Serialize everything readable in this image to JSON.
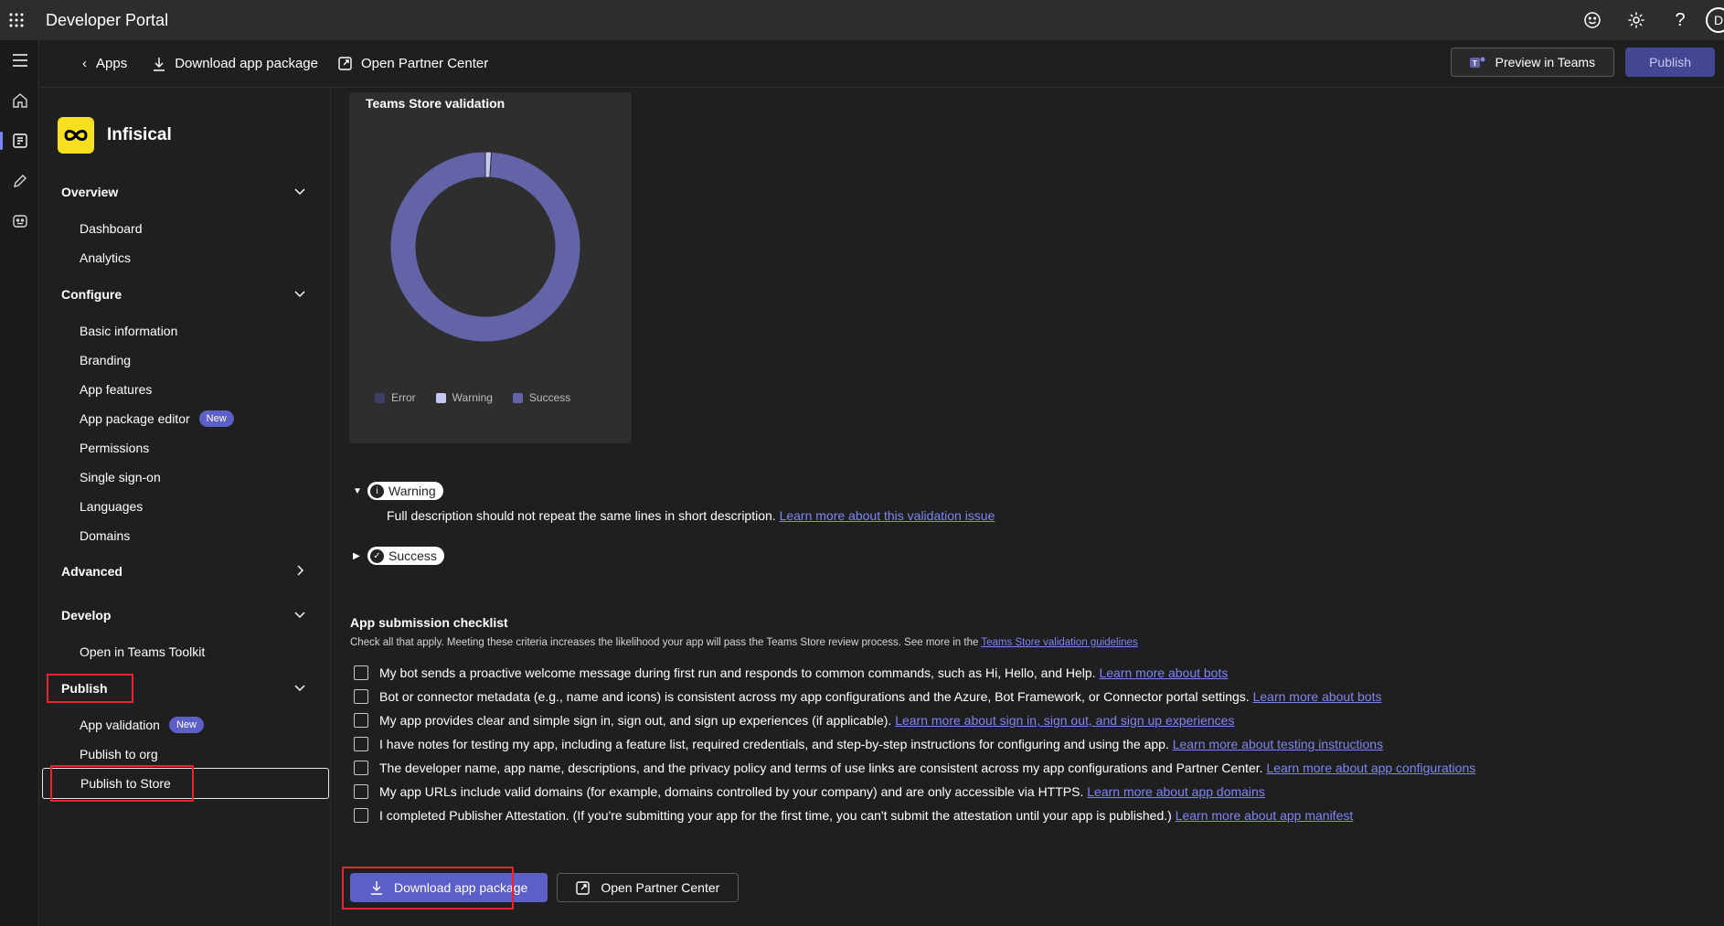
{
  "topbar": {
    "title": "Developer Portal",
    "avatar_initial": "D"
  },
  "cmdbar": {
    "back_label": "Apps",
    "download_label": "Download app package",
    "partner_label": "Open Partner Center",
    "preview_label": "Preview in Teams",
    "publish_label": "Publish"
  },
  "app": {
    "name": "Infisical"
  },
  "nav": {
    "overview": {
      "label": "Overview",
      "items": [
        "Dashboard",
        "Analytics"
      ]
    },
    "configure": {
      "label": "Configure",
      "items": [
        "Basic information",
        "Branding",
        "App features",
        "App package editor",
        "Permissions",
        "Single sign-on",
        "Languages",
        "Domains"
      ]
    },
    "new_badge": "New",
    "advanced": {
      "label": "Advanced"
    },
    "develop": {
      "label": "Develop",
      "items": [
        "Open in Teams Toolkit"
      ]
    },
    "publish": {
      "label": "Publish",
      "items": [
        "App validation",
        "Publish to org",
        "Publish to Store"
      ]
    }
  },
  "validation_card": {
    "title": "Teams Store validation",
    "legend": [
      "Error",
      "Warning",
      "Success"
    ],
    "colors": {
      "error": "#3d3e66",
      "warning": "#c5c8f5",
      "success": "#6264a7"
    }
  },
  "chart_data": {
    "type": "pie",
    "title": "Teams Store validation",
    "categories": [
      "Error",
      "Warning",
      "Success"
    ],
    "values": [
      0,
      1,
      97
    ]
  },
  "issues": {
    "warning_label": "Warning",
    "warning_text": "Full description should not repeat the same lines in short description.",
    "warning_link": "Learn more about this validation issue",
    "success_label": "Success"
  },
  "checklist": {
    "title": "App submission checklist",
    "subtitle": "Check all that apply. Meeting these criteria increases the likelihood your app will pass the Teams Store review process. See more in the",
    "subtitle_link": "Teams Store validation guidelines",
    "items": [
      {
        "text": "My bot sends a proactive welcome message during first run and responds to common commands, such as Hi, Hello, and Help.",
        "link": "Learn more about bots"
      },
      {
        "text": "Bot or connector metadata (e.g., name and icons) is consistent across my app configurations and the Azure, Bot Framework, or Connector portal settings.",
        "link": "Learn more about bots"
      },
      {
        "text": "My app provides clear and simple sign in, sign out, and sign up experiences (if applicable).",
        "link": "Learn more about sign in, sign out, and sign up experiences"
      },
      {
        "text": "I have notes for testing my app, including a feature list, required credentials, and step-by-step instructions for configuring and using the app.",
        "link": "Learn more about testing instructions"
      },
      {
        "text": "The developer name, app name, descriptions, and the privacy policy and terms of use links are consistent across my app configurations and Partner Center.",
        "link": "Learn more about app configurations"
      },
      {
        "text": "My app URLs include valid domains (for example, domains controlled by your company) and are only accessible via HTTPS.",
        "link": "Learn more about app domains"
      },
      {
        "text": "I completed Publisher Attestation. (If you're submitting your app for the first time, you can't submit the attestation until your app is published.)",
        "link": "Learn more about app manifest"
      }
    ]
  },
  "actions": {
    "download_label": "Download app package",
    "partner_label": "Open Partner Center"
  }
}
